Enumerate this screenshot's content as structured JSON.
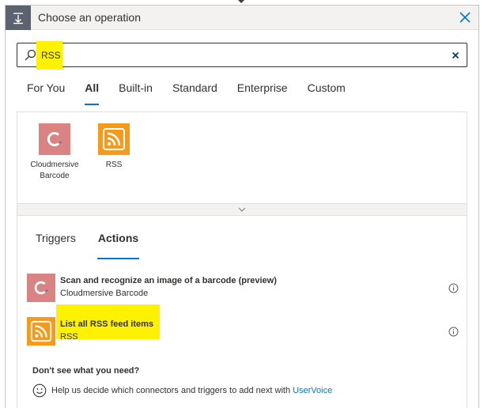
{
  "header": {
    "title": "Choose an operation",
    "icon": "download-to-icon",
    "close_icon": "close-icon"
  },
  "search": {
    "value": "RSS",
    "placeholder": "",
    "icon": "search-icon",
    "clear_icon": "clear-icon",
    "highlight_color": "#fff200"
  },
  "tabs": [
    {
      "label": "For You",
      "active": false
    },
    {
      "label": "All",
      "active": true
    },
    {
      "label": "Built-in",
      "active": false
    },
    {
      "label": "Standard",
      "active": false
    },
    {
      "label": "Enterprise",
      "active": false
    },
    {
      "label": "Custom",
      "active": false
    }
  ],
  "connectors": [
    {
      "label": "Cloudmersive Barcode",
      "icon": "cloudmersive-logo",
      "color": "#d98383"
    },
    {
      "label": "RSS",
      "icon": "rss-logo",
      "color": "#f59a1b"
    }
  ],
  "expand_icon": "chevron-down-icon",
  "subtabs": [
    {
      "label": "Triggers",
      "active": false
    },
    {
      "label": "Actions",
      "active": true
    }
  ],
  "actions": [
    {
      "title": "Scan and recognize an image of a barcode (preview)",
      "connector": "Cloudmersive Barcode",
      "icon": "cloudmersive-logo",
      "info_icon": "info-icon"
    },
    {
      "title": "List all RSS feed items",
      "connector": "RSS",
      "icon": "rss-logo",
      "info_icon": "info-icon",
      "highlighted": true
    }
  ],
  "help": {
    "question": "Don't see what you need?",
    "text": "Help us decide which connectors and triggers to add next with",
    "link": "UserVoice",
    "icon": "smile-icon"
  },
  "colors": {
    "accent": "#0078d4",
    "highlight": "#fff200",
    "header_icon_bg": "#5c6370"
  }
}
